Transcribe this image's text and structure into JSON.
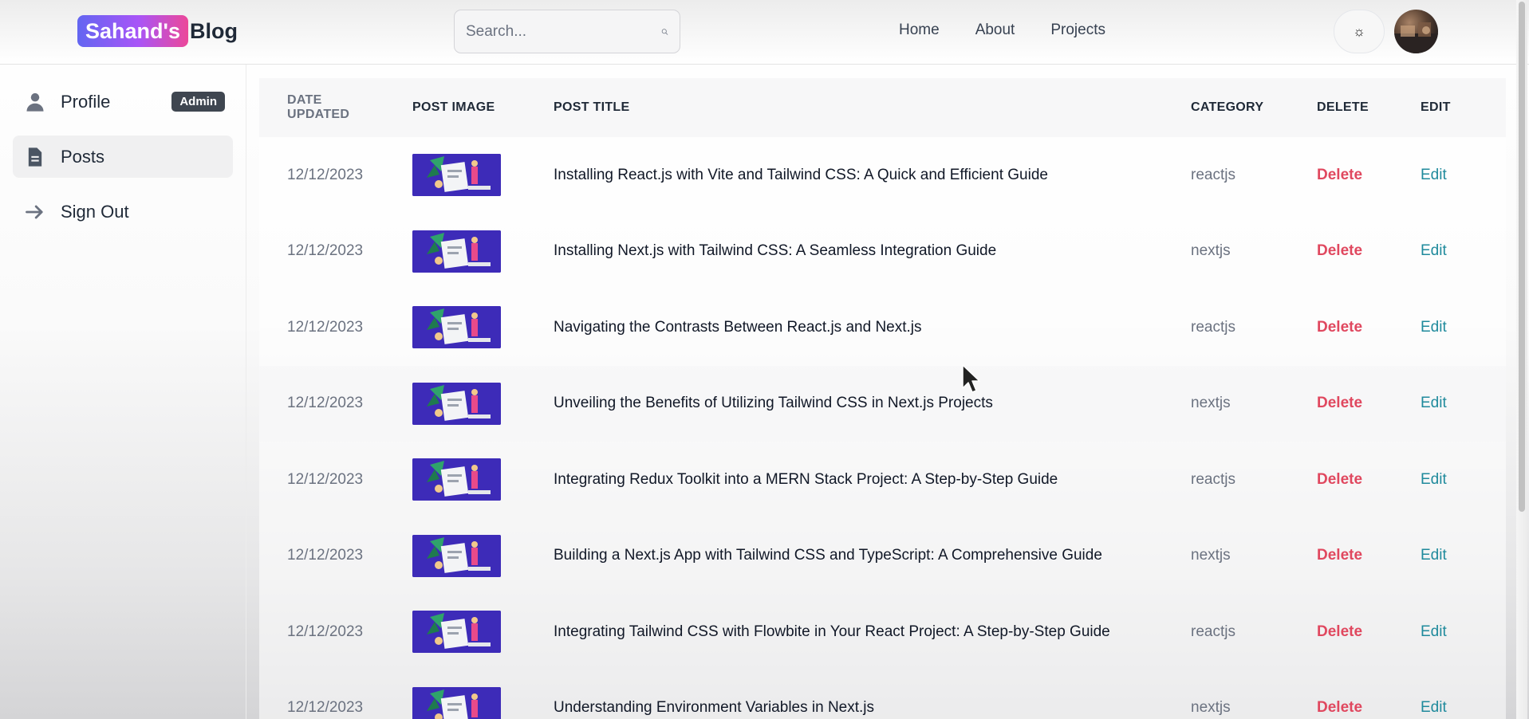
{
  "header": {
    "logo_badge": "Sahand's",
    "logo_text": "Blog",
    "search_placeholder": "Search...",
    "nav": [
      {
        "label": "Home"
      },
      {
        "label": "About"
      },
      {
        "label": "Projects"
      }
    ],
    "theme_icon": "☼"
  },
  "sidebar": {
    "items": [
      {
        "label": "Profile",
        "icon": "user-icon",
        "badge": "Admin"
      },
      {
        "label": "Posts",
        "icon": "document-icon",
        "active": true
      },
      {
        "label": "Sign Out",
        "icon": "arrow-right-icon"
      }
    ]
  },
  "table": {
    "headers": {
      "date_line1": "DATE",
      "date_line2": "UPDATED",
      "image": "POST IMAGE",
      "title": "POST TITLE",
      "category": "CATEGORY",
      "delete": "DELETE",
      "edit": "EDIT"
    },
    "rows": [
      {
        "date": "12/12/2023",
        "title": "Installing React.js with Vite and Tailwind CSS: A Quick and Efficient Guide",
        "category": "reactjs",
        "delete": "Delete",
        "edit": "Edit"
      },
      {
        "date": "12/12/2023",
        "title": "Installing Next.js with Tailwind CSS: A Seamless Integration Guide",
        "category": "nextjs",
        "delete": "Delete",
        "edit": "Edit"
      },
      {
        "date": "12/12/2023",
        "title": "Navigating the Contrasts Between React.js and Next.js",
        "category": "reactjs",
        "delete": "Delete",
        "edit": "Edit"
      },
      {
        "date": "12/12/2023",
        "title": "Unveiling the Benefits of Utilizing Tailwind CSS in Next.js Projects",
        "category": "nextjs",
        "delete": "Delete",
        "edit": "Edit"
      },
      {
        "date": "12/12/2023",
        "title": "Integrating Redux Toolkit into a MERN Stack Project: A Step-by-Step Guide",
        "category": "reactjs",
        "delete": "Delete",
        "edit": "Edit"
      },
      {
        "date": "12/12/2023",
        "title": "Building a Next.js App with Tailwind CSS and TypeScript: A Comprehensive Guide",
        "category": "nextjs",
        "delete": "Delete",
        "edit": "Edit"
      },
      {
        "date": "12/12/2023",
        "title": "Integrating Tailwind CSS with Flowbite in Your React Project: A Step-by-Step Guide",
        "category": "reactjs",
        "delete": "Delete",
        "edit": "Edit"
      },
      {
        "date": "12/12/2023",
        "title": "Understanding Environment Variables in Next.js",
        "category": "nextjs",
        "delete": "Delete",
        "edit": "Edit"
      }
    ]
  },
  "colors": {
    "logo_gradient_start": "#6366f1",
    "logo_gradient_end": "#ec4899",
    "delete": "#e0485f",
    "edit": "#1f8a9c",
    "thumb_bg": "#3d2bb8"
  }
}
